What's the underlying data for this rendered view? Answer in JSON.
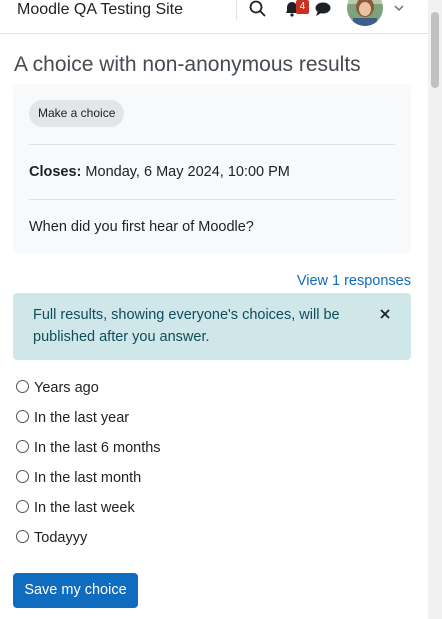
{
  "navbar": {
    "site_name": "Moodle QA Testing Site",
    "notification_count": "4",
    "icons": [
      "search-icon",
      "bell-icon",
      "chat-icon",
      "chevron-down-icon"
    ]
  },
  "page": {
    "title": "A choice with non-anonymous results"
  },
  "info": {
    "action_pill": "Make a choice",
    "closes_label": "Closes:",
    "closes_value": "Monday, 6 May 2024, 10:00 PM",
    "question": "When did you first hear of Moodle?"
  },
  "responses_link": "View 1 responses",
  "alert": {
    "text": "Full results, showing everyone's choices, will be published after you answer.",
    "close_icon": "close-icon"
  },
  "options": [
    "Years ago",
    "In the last year",
    "In the last 6 months",
    "In the last month",
    "In the last week",
    "Todayyy"
  ],
  "save_button": "Save my choice",
  "colors": {
    "primary": "#0f6cbf",
    "alert_bg": "#cfe7e9",
    "badge": "#ca3120"
  }
}
